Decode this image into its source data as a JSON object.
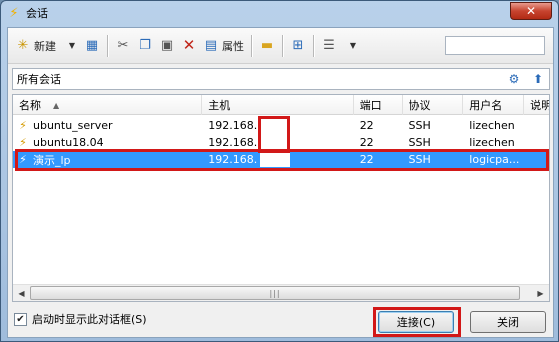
{
  "window": {
    "title": "会话",
    "close_label": "✕"
  },
  "toolbar": {
    "new_label": "新建",
    "properties_label": "属性",
    "search_value": ""
  },
  "path": {
    "label": "所有会话"
  },
  "columns": [
    "名称",
    "主机",
    "端口",
    "协议",
    "用户名",
    "说明"
  ],
  "sessions": [
    {
      "name": "ubuntu_server",
      "host": "192.168.",
      "port": "22",
      "protocol": "SSH",
      "user": "lizechen"
    },
    {
      "name": "ubuntu18.04",
      "host": "192.168.",
      "port": "22",
      "protocol": "SSH",
      "user": "lizechen"
    },
    {
      "name": "演示_lp",
      "host": "192.168.",
      "port": "22",
      "protocol": "SSH",
      "user": "logicpa..."
    }
  ],
  "selected_index": 2,
  "scrollbar": {
    "thumb_glyph": "|||"
  },
  "startup_checkbox": {
    "label": "启动时显示此对话框(S)",
    "checked": true
  },
  "buttons": {
    "connect": "连接(C)",
    "close": "关闭"
  },
  "colors": {
    "selection": "#3399ff",
    "highlight": "#d21818"
  }
}
